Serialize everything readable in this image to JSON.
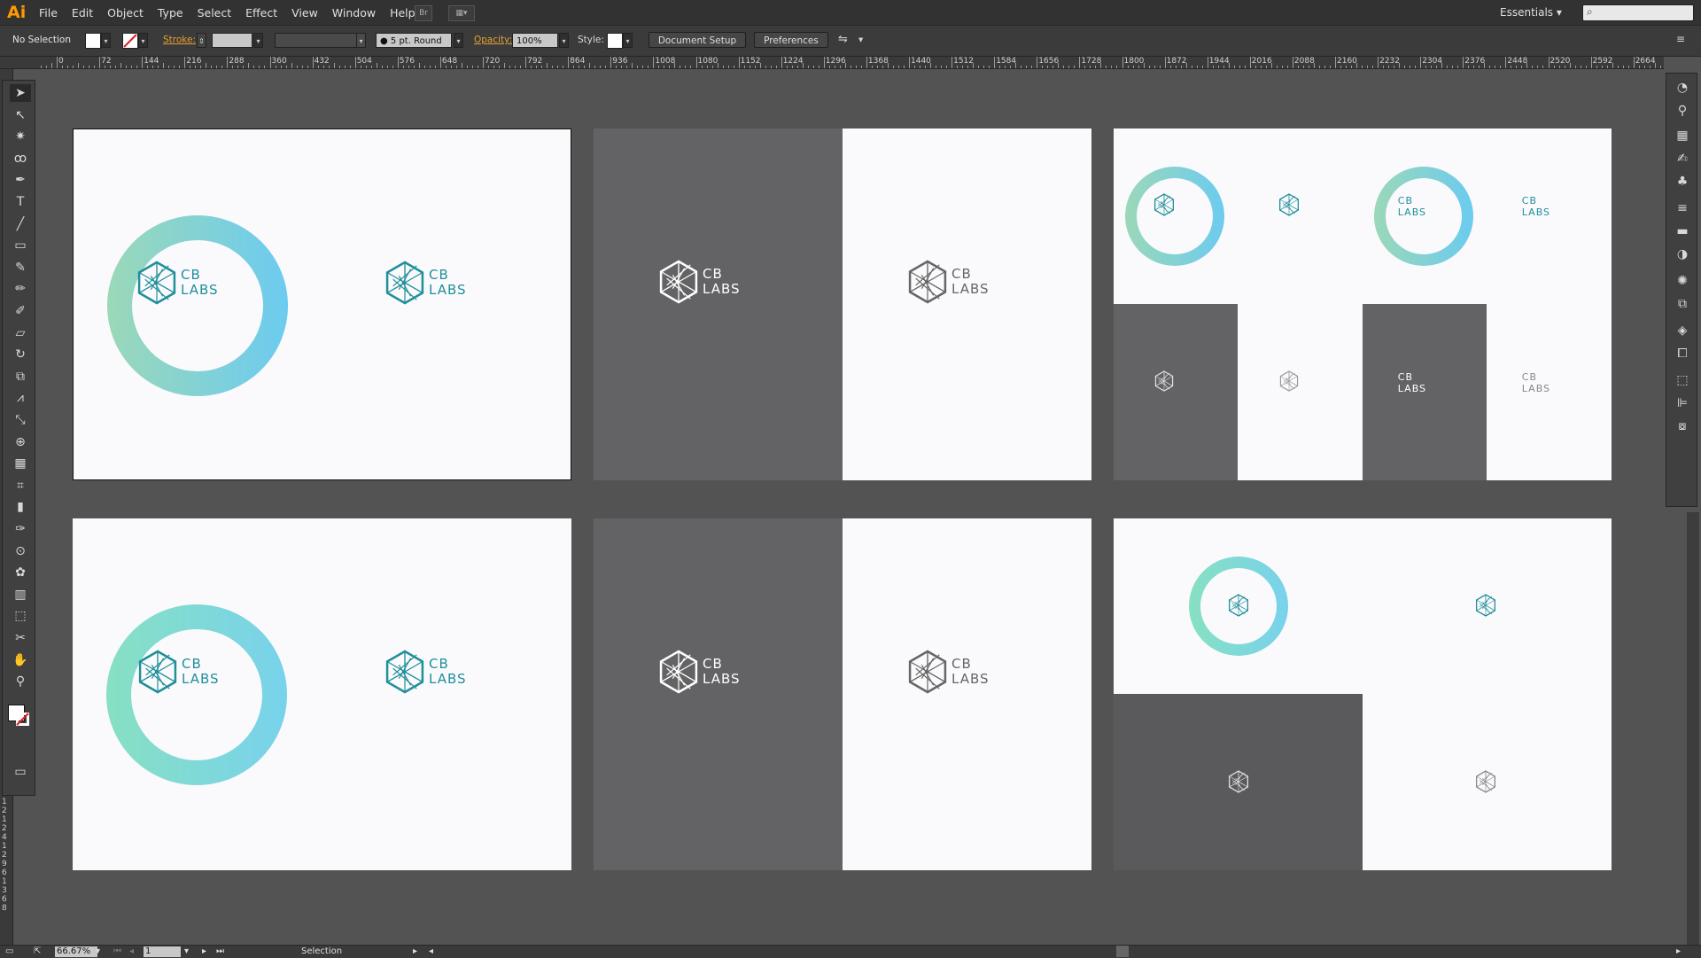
{
  "app": {
    "logo": "Ai"
  },
  "menu": [
    "File",
    "Edit",
    "Object",
    "Type",
    "Select",
    "Effect",
    "View",
    "Window",
    "Help"
  ],
  "workspace": "Essentials",
  "search": {
    "icon": "search-icon"
  },
  "control": {
    "selection": "No Selection",
    "stroke_label": "Stroke:",
    "brush": "5 pt. Round",
    "opacity_label": "Opacity:",
    "opacity": "100%",
    "style_label": "Style:",
    "document_setup": "Document Setup",
    "preferences": "Preferences"
  },
  "ruler_marks": [
    "2",
    "0",
    "72",
    "144",
    "216",
    "288",
    "360",
    "432",
    "504",
    "576",
    "648",
    "720",
    "792",
    "864",
    "936",
    "1008",
    "1080",
    "1152",
    "1224",
    "1296",
    "1368",
    "1440",
    "1512",
    "1584",
    "1656",
    "1728",
    "1800",
    "1872",
    "1944",
    "2016",
    "2088",
    "2160",
    "2232",
    "2304",
    "2376",
    "2448",
    "2520",
    "2592",
    "2664"
  ],
  "vruler_marks": [
    "1",
    "2",
    "1",
    "2",
    "4",
    "1",
    "2",
    "9",
    "6",
    "1",
    "3",
    "6",
    "8"
  ],
  "logo": {
    "line1": "CB",
    "line2": "LABS"
  },
  "colors": {
    "teal": "#1f8f9a",
    "ring_start": "#9bd8b8",
    "ring_end": "#6ccbf0",
    "dark_panel": "#636365",
    "canvas": "#535353"
  },
  "status": {
    "zoom": "66.67%",
    "page": "1",
    "tool": "Selection"
  },
  "tools": [
    "selection-tool",
    "direct-selection-tool",
    "magic-wand-tool",
    "lasso-tool",
    "pen-tool",
    "type-tool",
    "line-tool",
    "rectangle-tool",
    "paintbrush-tool",
    "pencil-tool",
    "blob-brush-tool",
    "eraser-tool",
    "rotate-tool",
    "scale-tool",
    "width-tool",
    "free-transform-tool",
    "shape-builder-tool",
    "perspective-grid-tool",
    "mesh-tool",
    "gradient-tool",
    "eyedropper-tool",
    "blend-tool",
    "symbol-sprayer-tool",
    "column-graph-tool",
    "artboard-tool",
    "slice-tool",
    "hand-tool",
    "zoom-tool"
  ]
}
